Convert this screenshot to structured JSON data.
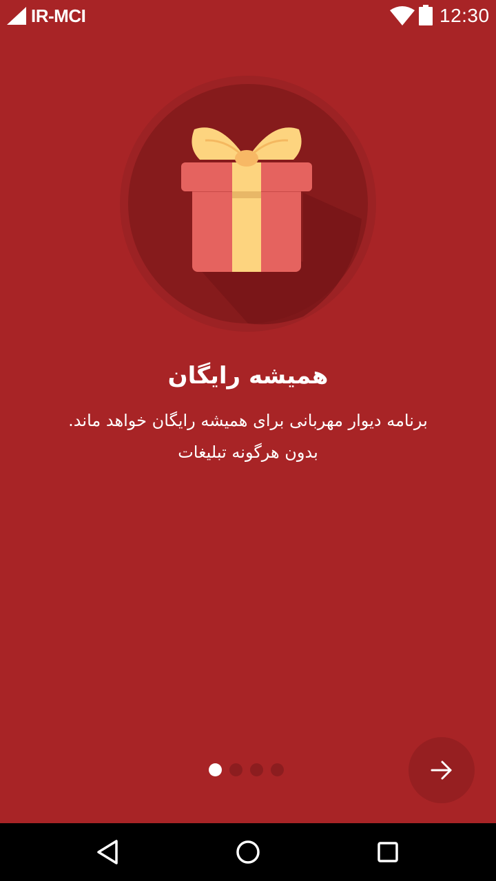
{
  "status_bar": {
    "carrier": "IR-MCI",
    "time": "12:30",
    "icons": [
      "signal-icon",
      "wifi-icon",
      "battery-icon"
    ]
  },
  "onboarding": {
    "illustration": "gift-icon",
    "title": "همیشه رایگان",
    "description_line1": "برنامه دیوار مهربانی برای همیشه رایگان خواهد ماند.",
    "description_line2": "بدون هرگونه تبلیغات",
    "page_index": 1,
    "page_count": 4
  },
  "next_button": {
    "icon": "arrow-right-icon"
  },
  "nav_bar": {
    "icons": [
      "back-icon",
      "home-icon",
      "recents-icon"
    ]
  },
  "colors": {
    "background": "#a82426",
    "circle_outer": "#9c2224",
    "circle_inner": "#861b1c",
    "gift_box": "#e5635f",
    "gift_ribbon": "#fdd47f",
    "dot_inactive": "#8c1d1f",
    "dot_active": "#ffffff"
  }
}
